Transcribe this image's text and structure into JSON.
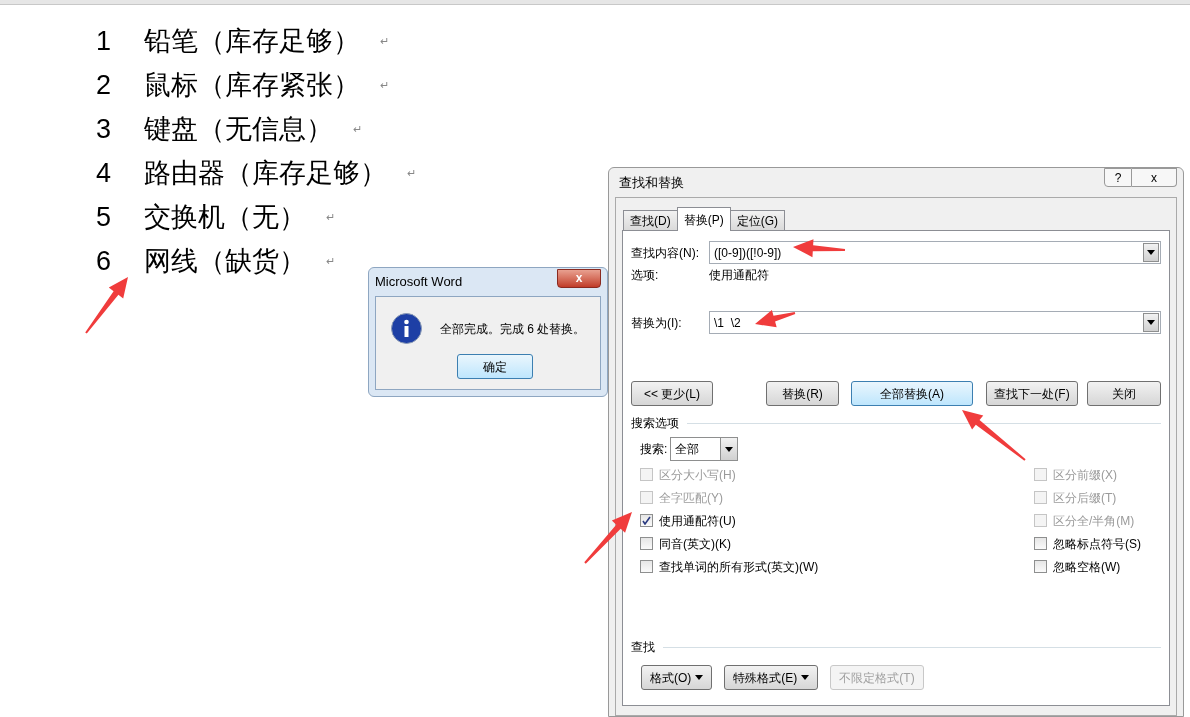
{
  "document": {
    "lines": [
      {
        "number": "1",
        "text": "铅笔（库存足够）",
        "mark": "↵"
      },
      {
        "number": "2",
        "text": "鼠标（库存紧张）",
        "mark": "↵"
      },
      {
        "number": "3",
        "text": "键盘（无信息）",
        "mark": "↵"
      },
      {
        "number": "4",
        "text": "路由器（库存足够）",
        "mark": "↵"
      },
      {
        "number": "5",
        "text": "交换机（无）",
        "mark": "↵"
      },
      {
        "number": "6",
        "text": "网线（缺货）",
        "mark": "↵"
      }
    ]
  },
  "message_box": {
    "title": "Microsoft Word",
    "close": "x",
    "message": "全部完成。完成 6 处替换。",
    "button": "确定"
  },
  "find_replace": {
    "title": "查找和替换",
    "help": "?",
    "close": "x",
    "tabs": [
      {
        "label": "查找(D)",
        "selected": false
      },
      {
        "label": "替换(P)",
        "selected": true
      },
      {
        "label": "定位(G)",
        "selected": false
      }
    ],
    "find": {
      "label": "查找内容(N):",
      "value": "([0-9])([!0-9])"
    },
    "options_label": "选项:",
    "options_value": "使用通配符",
    "replace": {
      "label": "替换为(I):",
      "value": "\\1  \\2"
    },
    "buttons": [
      {
        "label": "<< 更少(L)",
        "default": false
      },
      {
        "label": "替换(R)",
        "default": false
      },
      {
        "label": "全部替换(A)",
        "default": true
      },
      {
        "label": "查找下一处(F)",
        "default": false
      },
      {
        "label": "关闭",
        "default": false
      }
    ],
    "search_options_title": "搜索选项",
    "search": {
      "label": "搜索:",
      "value": "全部"
    },
    "left_options": [
      {
        "label": "区分大小写(H)",
        "checked": false,
        "disabled": true
      },
      {
        "label": "全字匹配(Y)",
        "checked": false,
        "disabled": true
      },
      {
        "label": "使用通配符(U)",
        "checked": true,
        "disabled": false
      },
      {
        "label": "同音(英文)(K)",
        "checked": false,
        "disabled": false
      },
      {
        "label": "查找单词的所有形式(英文)(W)",
        "checked": false,
        "disabled": false
      }
    ],
    "right_options": [
      {
        "label": "区分前缀(X)",
        "checked": false,
        "disabled": true
      },
      {
        "label": "区分后缀(T)",
        "checked": false,
        "disabled": true
      },
      {
        "label": "区分全/半角(M)",
        "checked": false,
        "disabled": true
      },
      {
        "label": "忽略标点符号(S)",
        "checked": false,
        "disabled": false
      },
      {
        "label": "忽略空格(W)",
        "checked": false,
        "disabled": false
      }
    ],
    "find_section_title": "查找",
    "format_buttons": [
      {
        "label": "格式(O)",
        "menu": true,
        "disabled": false
      },
      {
        "label": "特殊格式(E)",
        "menu": true,
        "disabled": false
      },
      {
        "label": "不限定格式(T)",
        "menu": false,
        "disabled": true
      }
    ]
  }
}
